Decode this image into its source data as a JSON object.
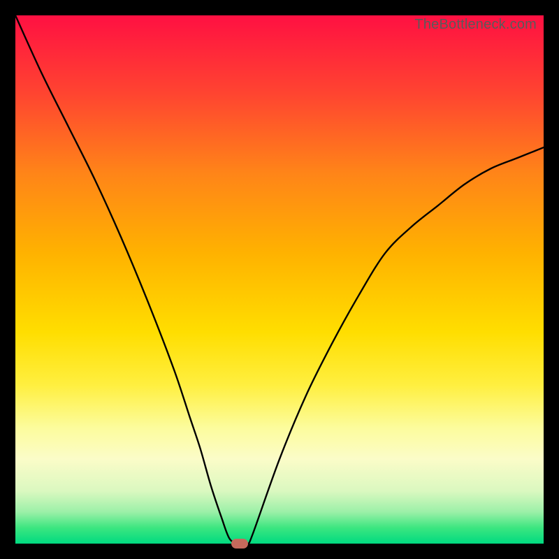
{
  "watermark": "TheBottleneck.com",
  "chart_data": {
    "type": "line",
    "title": "",
    "xlabel": "",
    "ylabel": "",
    "ylim": [
      0,
      100
    ],
    "xlim": [
      0,
      100
    ],
    "series": [
      {
        "name": "curve",
        "x": [
          0,
          5,
          10,
          15,
          20,
          25,
          30,
          33,
          35,
          37,
          39,
          40.5,
          42,
          43,
          44,
          45,
          50,
          55,
          60,
          65,
          70,
          75,
          80,
          85,
          90,
          95,
          100
        ],
        "y": [
          100,
          89,
          79,
          69,
          58,
          46,
          33,
          24,
          18,
          11,
          5,
          1,
          0,
          0,
          0,
          2,
          16,
          28,
          38,
          47,
          55,
          60,
          64,
          68,
          71,
          73,
          75
        ]
      }
    ],
    "marker": {
      "x": 42.5,
      "y": 0
    },
    "gradient_stops": [
      {
        "pct": 0,
        "color": "#ff1042"
      },
      {
        "pct": 15,
        "color": "#ff4530"
      },
      {
        "pct": 30,
        "color": "#ff8518"
      },
      {
        "pct": 45,
        "color": "#ffb200"
      },
      {
        "pct": 60,
        "color": "#ffde00"
      },
      {
        "pct": 70,
        "color": "#ffef40"
      },
      {
        "pct": 78,
        "color": "#fcfc9c"
      },
      {
        "pct": 84,
        "color": "#fbfcc8"
      },
      {
        "pct": 90,
        "color": "#dbf8c0"
      },
      {
        "pct": 94,
        "color": "#9cf0a8"
      },
      {
        "pct": 97,
        "color": "#3ce680"
      },
      {
        "pct": 100,
        "color": "#00da80"
      }
    ]
  }
}
